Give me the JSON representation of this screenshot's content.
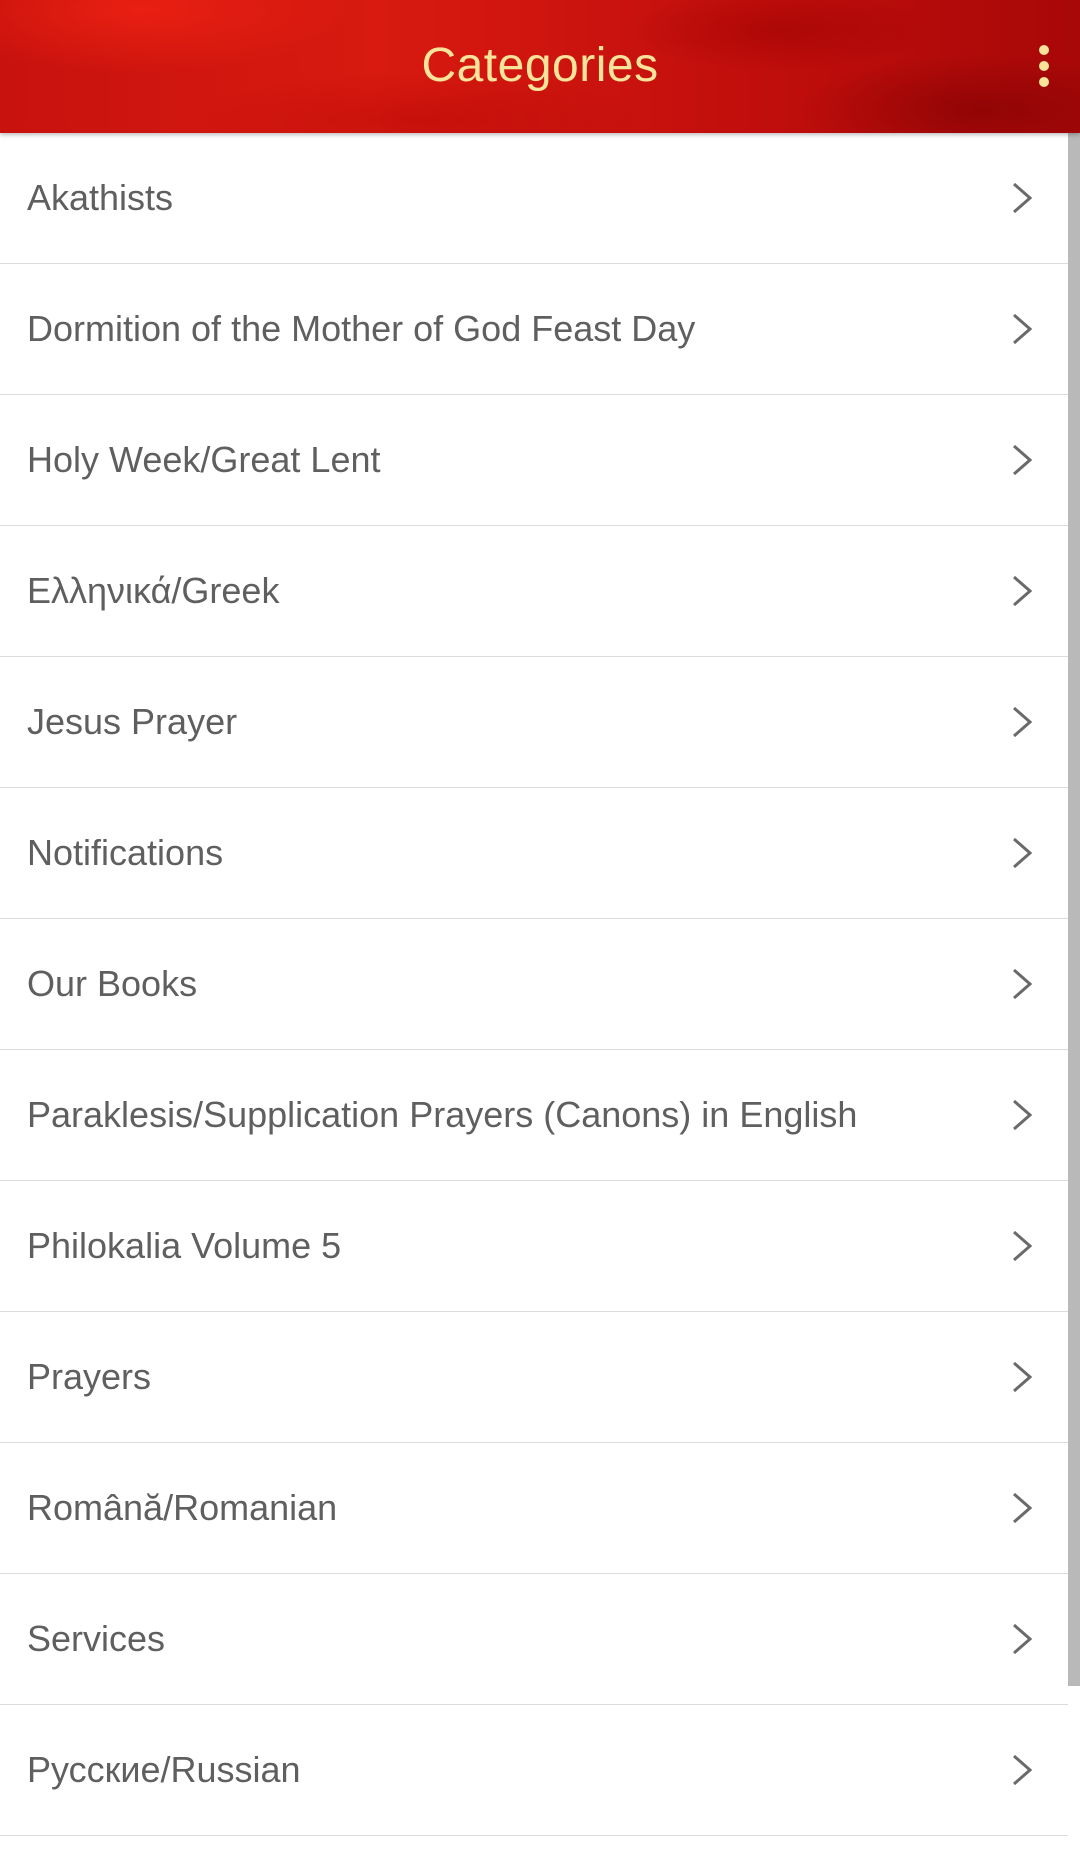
{
  "appbar": {
    "title": "Categories",
    "menu_icon": "more-vert-icon"
  },
  "categories": [
    {
      "label": "Akathists"
    },
    {
      "label": "Dormition of the Mother of God Feast Day"
    },
    {
      "label": "Holy Week/Great Lent"
    },
    {
      "label": "Ελληνικά/Greek"
    },
    {
      "label": "Jesus Prayer"
    },
    {
      "label": "Notifications"
    },
    {
      "label": "Our Books"
    },
    {
      "label": "Paraklesis/Supplication Prayers (Canons) in English"
    },
    {
      "label": "Philokalia Volume 5"
    },
    {
      "label": "Prayers"
    },
    {
      "label": "Română/Romanian"
    },
    {
      "label": "Services"
    },
    {
      "label": "Русские/Russian"
    }
  ],
  "row_icon": "chevron-right-icon",
  "colors": {
    "appbar_red": "#c8120e",
    "title_yellow": "#f7e39a",
    "label_gray": "#5f5f5f",
    "divider": "#dcdcdc"
  }
}
